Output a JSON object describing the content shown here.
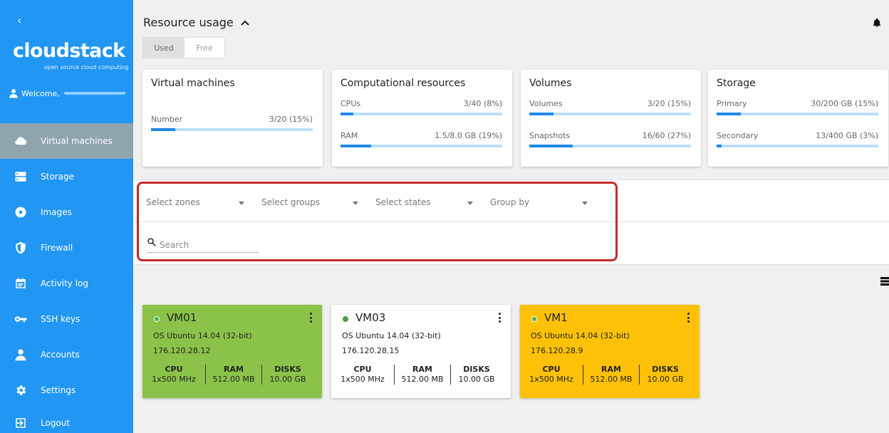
{
  "sidebar": {
    "collapse_glyph": "‹",
    "logo": "cloudstack",
    "logo_sub": "open source cloud computing",
    "welcome": "Welcome,",
    "items": [
      {
        "label": "Virtual machines",
        "icon": "cloud-icon",
        "active": true
      },
      {
        "label": "Storage",
        "icon": "storage-icon",
        "active": false
      },
      {
        "label": "Images",
        "icon": "disc-icon",
        "active": false
      },
      {
        "label": "Firewall",
        "icon": "shield-icon",
        "active": false
      },
      {
        "label": "Activity log",
        "icon": "calendar-icon",
        "active": false
      },
      {
        "label": "SSH keys",
        "icon": "key-icon",
        "active": false
      },
      {
        "label": "Accounts",
        "icon": "person-icon",
        "active": false
      },
      {
        "label": "Settings",
        "icon": "gear-icon",
        "active": false
      },
      {
        "label": "Logout",
        "icon": "logout-icon",
        "active": false
      }
    ]
  },
  "resource": {
    "title": "Resource usage",
    "toggle": {
      "used": "Used",
      "free": "Free",
      "selected": "Used"
    },
    "cards": [
      {
        "title": "Virtual machines",
        "metrics": [
          {
            "label": "Number",
            "value": "3/20 (15%)",
            "percent": 15
          }
        ]
      },
      {
        "title": "Computational resources",
        "metrics": [
          {
            "label": "CPUs",
            "value": "3/40 (8%)",
            "percent": 8
          },
          {
            "label": "RAM",
            "value": "1.5/8.0 GB (19%)",
            "percent": 19
          }
        ]
      },
      {
        "title": "Volumes",
        "metrics": [
          {
            "label": "Volumes",
            "value": "3/20 (15%)",
            "percent": 15
          },
          {
            "label": "Snapshots",
            "value": "16/60 (27%)",
            "percent": 27
          }
        ]
      },
      {
        "title": "Storage",
        "metrics": [
          {
            "label": "Primary",
            "value": "30/200 GB (15%)",
            "percent": 15
          },
          {
            "label": "Secondary",
            "value": "13/400 GB (3%)",
            "percent": 3
          }
        ]
      }
    ]
  },
  "filters": {
    "zones": "Select zones",
    "groups": "Select groups",
    "states": "Select states",
    "group_by": "Group by",
    "search_placeholder": "Search"
  },
  "vms": [
    {
      "name": "VM01",
      "os": "OS Ubuntu 14.04 (32-bit)",
      "ip": "176.120.28.12",
      "cpu_label": "CPU",
      "cpu": "1x500 MHz",
      "ram_label": "RAM",
      "ram": "512.00 MB",
      "disks_label": "DISKS",
      "disks": "10.00 GB",
      "color": "#8bc34a"
    },
    {
      "name": "VM03",
      "os": "OS Ubuntu 14.04 (32-bit)",
      "ip": "176.120.28.15",
      "cpu_label": "CPU",
      "cpu": "1x500 MHz",
      "ram_label": "RAM",
      "ram": "512.00 MB",
      "disks_label": "DISKS",
      "disks": "10.00 GB",
      "color": "#ffffff"
    },
    {
      "name": "VM1",
      "os": "OS Ubuntu 14.04 (32-bit)",
      "ip": "176.120.28.9",
      "cpu_label": "CPU",
      "cpu": "1x500 MHz",
      "ram_label": "RAM",
      "ram": "512.00 MB",
      "disks_label": "DISKS",
      "disks": "10.00 GB",
      "color": "#ffc107"
    }
  ],
  "colors": {
    "sidebar": "#2196f3",
    "active_nav": "#90a4ae",
    "bar": "#1e88e5",
    "highlight": "#c62828"
  }
}
